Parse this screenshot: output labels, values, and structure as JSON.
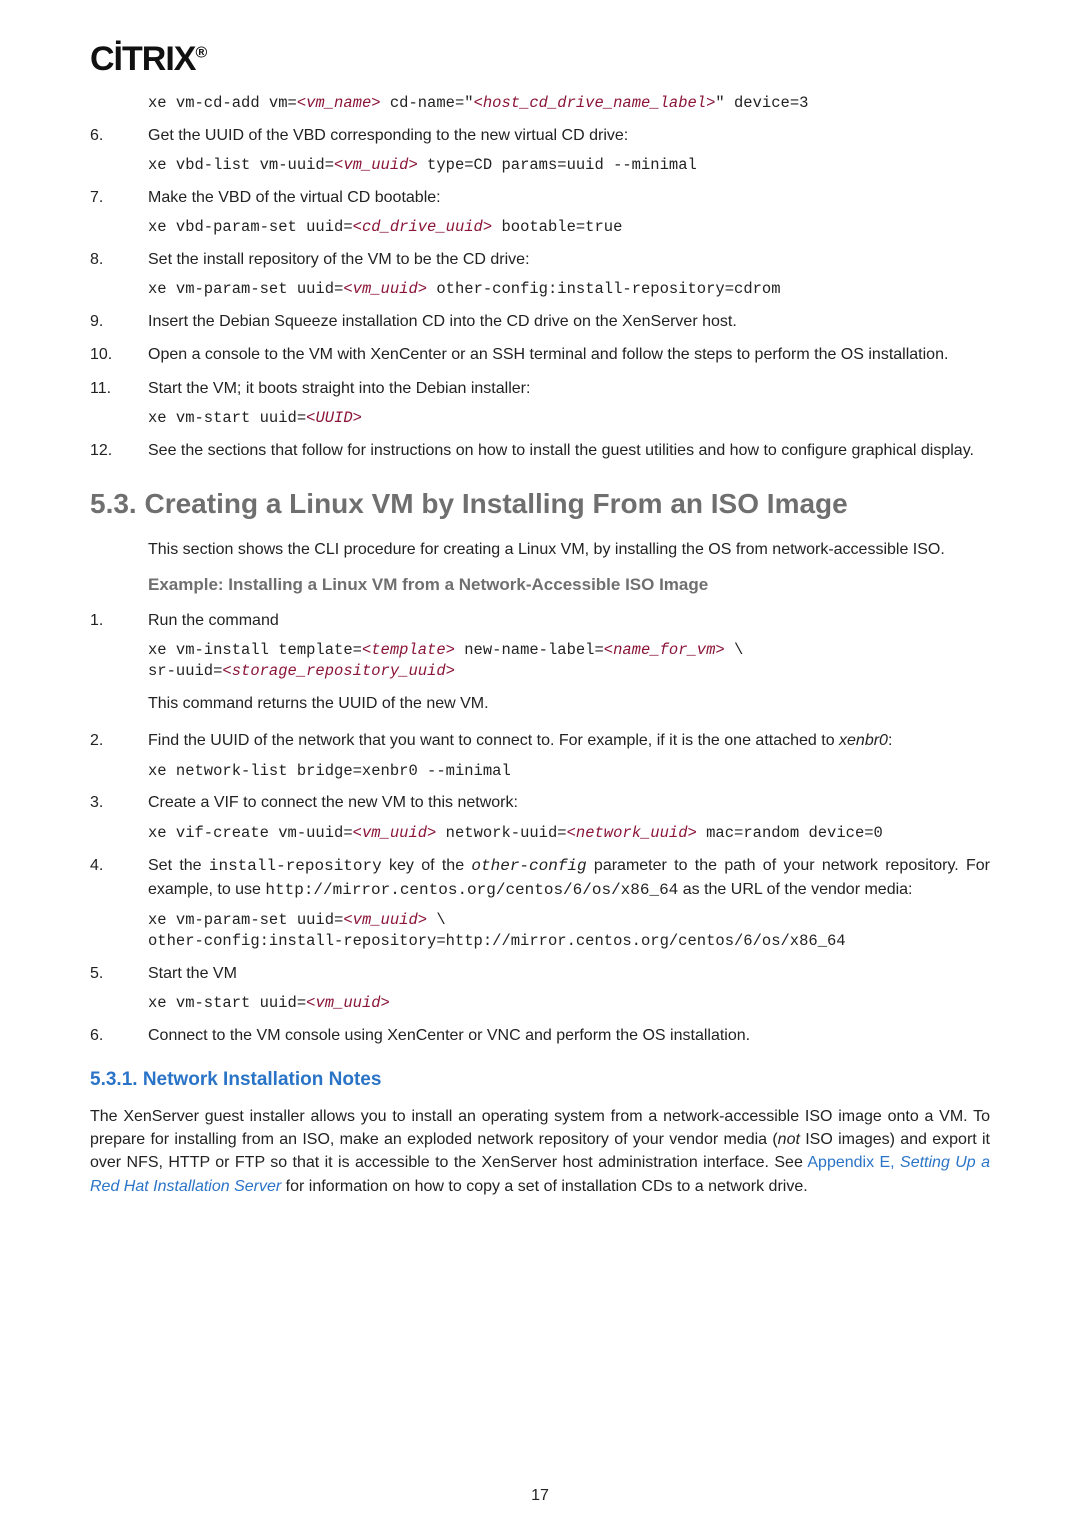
{
  "logo": "CİTRIX",
  "logo_dot": "®",
  "page_number": "17",
  "topsteps": [
    {
      "n": "6.",
      "text": "Get the UUID of the VBD corresponding to the new virtual CD drive:"
    },
    {
      "n": "7.",
      "text": "Make the VBD of the virtual CD bootable:"
    },
    {
      "n": "8.",
      "text": "Set the install repository of the VM to be the CD drive:"
    },
    {
      "n": "9.",
      "text": "Insert the Debian Squeeze installation CD into the CD drive on the XenServer host."
    },
    {
      "n": "10.",
      "text": "Open a console to the VM with XenCenter or an SSH terminal and follow the steps to perform the OS installation."
    },
    {
      "n": "11.",
      "text": "Start the VM; it boots straight into the Debian installer:"
    },
    {
      "n": "12.",
      "text": "See the sections that follow for instructions on how to install the guest utilities and how to configure graphical display."
    }
  ],
  "code": {
    "cd_add_a": "xe vm-cd-add vm=",
    "cd_add_vm": "<vm_name>",
    "cd_add_b": " cd-name=\"",
    "cd_add_label": "<host_cd_drive_name_label>",
    "cd_add_c": "\" device=3",
    "vbd_list_a": "xe vbd-list vm-uuid=",
    "vbd_list_kw": "<vm_uuid>",
    "vbd_list_b": " type=CD params=uuid --minimal",
    "vbd_set_a": "xe vbd-param-set uuid=",
    "vbd_set_kw": "<cd_drive_uuid>",
    "vbd_set_b": " bootable=true",
    "vm_set_a": "xe vm-param-set uuid=",
    "vm_set_kw": "<vm_uuid>",
    "vm_set_b": " other-config:install-repository=cdrom",
    "vm_start_a": "xe vm-start uuid=",
    "vm_start_kw": "<UUID>",
    "install_a": "xe vm-install template=",
    "install_tpl": "<template>",
    "install_b": " new-name-label=",
    "install_name": "<name_for_vm>",
    "install_c": " \\\nsr-uuid=",
    "install_sr": "<storage_repository_uuid>",
    "netlist": "xe network-list bridge=xenbr0 --minimal",
    "vif_a": "xe vif-create vm-uuid=",
    "vif_vm": "<vm_uuid>",
    "vif_b": " network-uuid=",
    "vif_net": "<network_uuid>",
    "vif_c": " mac=random device=0",
    "repo_a": "xe vm-param-set uuid=",
    "repo_vm": "<vm_uuid>",
    "repo_b": " \\\nother-config:install-repository=http://mirror.centos.org/centos/6/os/x86_64",
    "start2_a": "xe vm-start uuid=",
    "start2_kw": "<vm_uuid>"
  },
  "section_title": "5.3. Creating a Linux VM by Installing From an ISO Image",
  "section_intro": "This section shows the CLI procedure for creating a Linux VM, by installing the OS from network-accessible ISO.",
  "example_title": "Example: Installing a Linux VM from a Network-Accessible ISO Image",
  "ex_steps": {
    "s1": {
      "n": "1.",
      "text": "Run the command",
      "after": "This command returns the UUID of the new VM."
    },
    "s2": {
      "n": "2.",
      "pre": "Find the UUID of the network that you want to connect to. For example, if it is the one attached to ",
      "em": "xenbr0",
      "post": ":"
    },
    "s3": {
      "n": "3.",
      "text": "Create a VIF to connect the new VM to this network:"
    },
    "s4": {
      "n": "4.",
      "a": "Set the ",
      "m1": "install-repository",
      "b": " key of the ",
      "m2": "other-config",
      "c": " parameter to the path of your network repository. For example, to use ",
      "m3": "http://mirror.centos.org/centos/6/os/x86_64",
      "d": " as the URL of the vendor media:"
    },
    "s5": {
      "n": "5.",
      "text": "Start the VM"
    },
    "s6": {
      "n": "6.",
      "text": "Connect to the VM console using XenCenter or VNC and perform the OS installation."
    }
  },
  "subsection_title": "5.3.1. Network Installation Notes",
  "notes": {
    "a": "The XenServer guest installer allows you to install an operating system from a network-accessible ISO image onto a VM. To prepare for installing from an ISO, make an exploded network repository of your vendor media (",
    "not": "not",
    "b": " ISO images) and export it over NFS, HTTP or FTP so that it is accessible to the XenServer host administration interface. See ",
    "link1": "Appendix E, ",
    "link2": "Setting Up a Red Hat Installation Server",
    "c": " for information on how to copy a set of installation CDs to a network drive."
  }
}
